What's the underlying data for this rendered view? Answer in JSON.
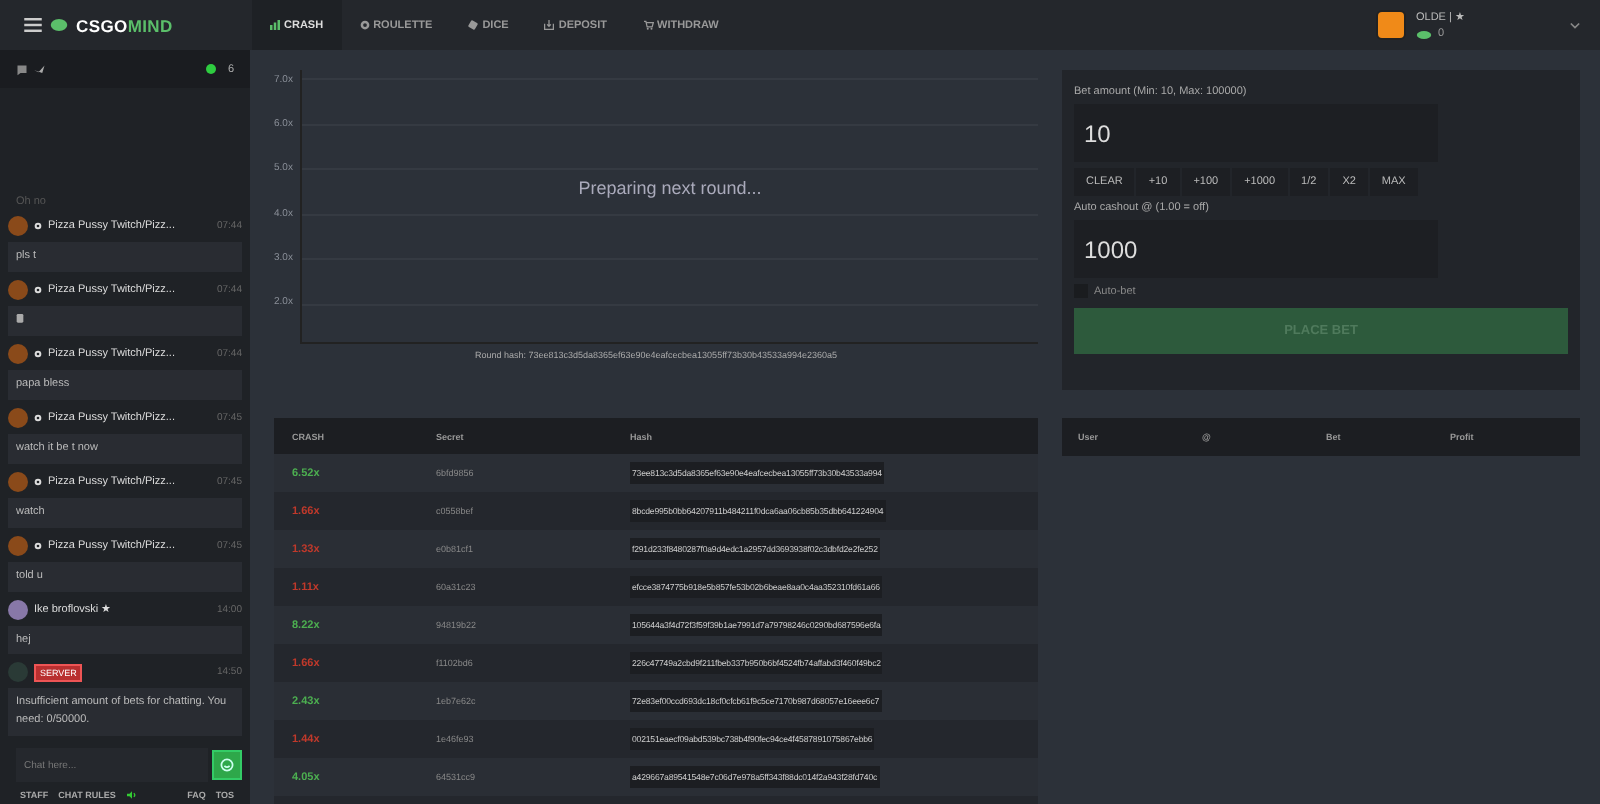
{
  "header": {
    "logo": {
      "part1": "CSGO",
      "part2": "MIND"
    },
    "nav": [
      {
        "label": "CRASH",
        "selected": true,
        "kind": "chart"
      },
      {
        "label": "ROULETTE",
        "selected": false,
        "kind": "wheel"
      },
      {
        "label": "DICE",
        "selected": false,
        "kind": "dice"
      },
      {
        "label": "DEPOSIT",
        "selected": false,
        "kind": "deposit"
      },
      {
        "label": "WITHDRAW",
        "selected": false,
        "kind": "cart"
      }
    ],
    "user": {
      "name": "OLDE | ★",
      "balance": "0"
    }
  },
  "chat": {
    "online_count": "6",
    "partial_message": "Oh no",
    "messages": [
      {
        "kind": "user",
        "name": "Pizza Pussy Twitch/Pizz...",
        "time": "07:44",
        "text": "pls t"
      },
      {
        "kind": "user",
        "name": "Pizza Pussy Twitch/Pizz...",
        "time": "07:44"
      },
      {
        "kind": "user",
        "name": "Pizza Pussy Twitch/Pizz...",
        "time": "07:44",
        "text": "papa bless"
      },
      {
        "kind": "user",
        "name": "Pizza Pussy Twitch/Pizz...",
        "time": "07:45",
        "text": "watch it be t now"
      },
      {
        "kind": "user",
        "name": "Pizza Pussy Twitch/Pizz...",
        "time": "07:45",
        "text": "watch"
      },
      {
        "kind": "user",
        "name": "Pizza Pussy Twitch/Pizz...",
        "time": "07:45",
        "text": "told u"
      },
      {
        "kind": "plain",
        "name": "Ike broflovski ★",
        "time": "14:00",
        "text": "hej"
      },
      {
        "kind": "server",
        "name": "SERVER",
        "time": "14:50",
        "text": "Insufficient amount of bets for chatting. You need: 0/50000."
      }
    ],
    "input": {
      "placeholder": "Chat here..."
    },
    "footer_links": [
      "STAFF",
      "CHAT RULES"
    ],
    "footer_links_right": [
      "FAQ",
      "TOS"
    ]
  },
  "graph": {
    "y_axis_labels": [
      "7.0x",
      "6.0x",
      "5.0x",
      "4.0x",
      "3.0x",
      "2.0x"
    ],
    "status": "Preparing next round...",
    "round_hash": "Round hash: 73ee813c3d5da8365ef63e90e4eafcecbea13055ff73b30b43533a994e2360a5"
  },
  "bet": {
    "amount_label": "Bet amount (Min: 10, Max: 100000)",
    "amount_value": "10",
    "quick_buttons": [
      "CLEAR",
      "+10",
      "+100",
      "+1000",
      "1/2",
      "X2",
      "MAX"
    ],
    "cashout_label": "Auto cashout @ (1.00 = off)",
    "cashout_value": "1000",
    "auto_bet": {
      "label": "Auto-bet",
      "checked": false
    },
    "place_bet": {
      "label": "PLACE BET",
      "disabled": true
    }
  },
  "history": {
    "columns": [
      "CRASH",
      "Secret",
      "Hash"
    ],
    "rows": [
      {
        "crash": "6.52x",
        "color": "#4caf50",
        "secret": "6bfd9856",
        "hash": "73ee813c3d5da8365ef63e90e4eafcecbea13055ff73b30b43533a994"
      },
      {
        "crash": "1.66x",
        "color": "#c0392b",
        "secret": "c0558bef",
        "hash": "8bcde995b0bb64207911b484211f0dca6aa06cb85b35dbb641224904"
      },
      {
        "crash": "1.33x",
        "color": "#c0392b",
        "secret": "e0b81cf1",
        "hash": "f291d233f8480287f0a9d4edc1a2957dd3693938f02c3dbfd2e2fe252"
      },
      {
        "crash": "1.11x",
        "color": "#c0392b",
        "secret": "60a31c23",
        "hash": "efcce3874775b918e5b857fe53b02b6beae8aa0c4aa352310fd61a66"
      },
      {
        "crash": "8.22x",
        "color": "#4caf50",
        "secret": "94819b22",
        "hash": "105644a3f4d72f3f59f39b1ae7991d7a79798246c0290bd687596e6fa"
      },
      {
        "crash": "1.66x",
        "color": "#c0392b",
        "secret": "f1102bd6",
        "hash": "226c47749a2cbd9f211fbeb337b950b6bf4524fb74affabd3f460f49bc2"
      },
      {
        "crash": "2.43x",
        "color": "#4caf50",
        "secret": "1eb7e62c",
        "hash": "72e83ef00ccd693dc18cf0cfcb61f9c5ce7170b987d68057e16eee6c7"
      },
      {
        "crash": "1.44x",
        "color": "#c0392b",
        "secret": "1e46fe93",
        "hash": "002151eaecf09abd539bc738b4f90fec94ce4f4587891075867ebb6"
      },
      {
        "crash": "4.05x",
        "color": "#4caf50",
        "secret": "64531cc9",
        "hash": "a429667a89541548e7c06d7e978a5ff343f88dc014f2a943f28fd740c"
      }
    ]
  },
  "players": {
    "columns": [
      "User",
      "@",
      "Bet",
      "Profit"
    ]
  }
}
